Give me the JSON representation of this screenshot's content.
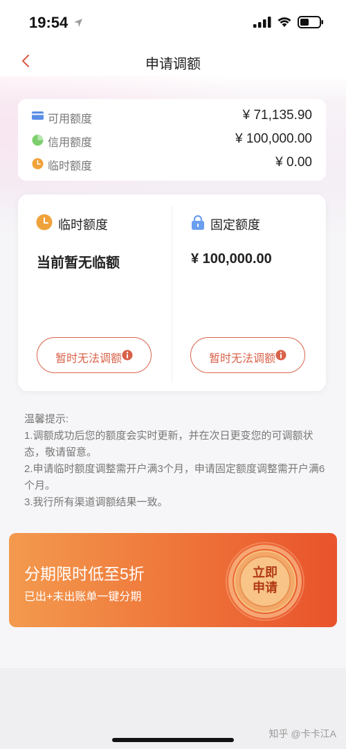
{
  "status_bar": {
    "time": "19:54"
  },
  "nav": {
    "title": "申请调额"
  },
  "summary": {
    "rows": [
      {
        "label": "可用额度",
        "value": "¥ 71,135.90",
        "icon": "card-icon",
        "icon_color": "#5b8ee6"
      },
      {
        "label": "信用额度",
        "value": "¥ 100,000.00",
        "icon": "pie-icon",
        "icon_color": "#7ccf6c"
      },
      {
        "label": "临时额度",
        "value": "¥ 0.00",
        "icon": "clock-icon",
        "icon_color": "#f0a23a"
      }
    ]
  },
  "temp_limit": {
    "title": "临时额度",
    "status": "当前暂无临额",
    "button": "暂时无法调额"
  },
  "fixed_limit": {
    "title": "固定额度",
    "amount": "¥ 100,000.00",
    "button": "暂时无法调额"
  },
  "tips": [
    "温馨提示:",
    "1.调额成功后您的额度会实时更新，并在次日更变您的可调额状态，敬请留意。",
    "2.申请临时额度调整需开户满3个月，申请固定额度调整需开户满6个月。",
    "3.我行所有渠道调额结果一致。"
  ],
  "banner": {
    "title": "分期限时低至5折",
    "subtitle": "已出+未出账单一键分期",
    "badge_line1": "立即",
    "badge_line2": "申请"
  },
  "watermark": "知乎 @卡卡江A",
  "colors": {
    "accent": "#d9624a",
    "banner_start": "#f39a4e",
    "banner_end": "#e9532c"
  }
}
